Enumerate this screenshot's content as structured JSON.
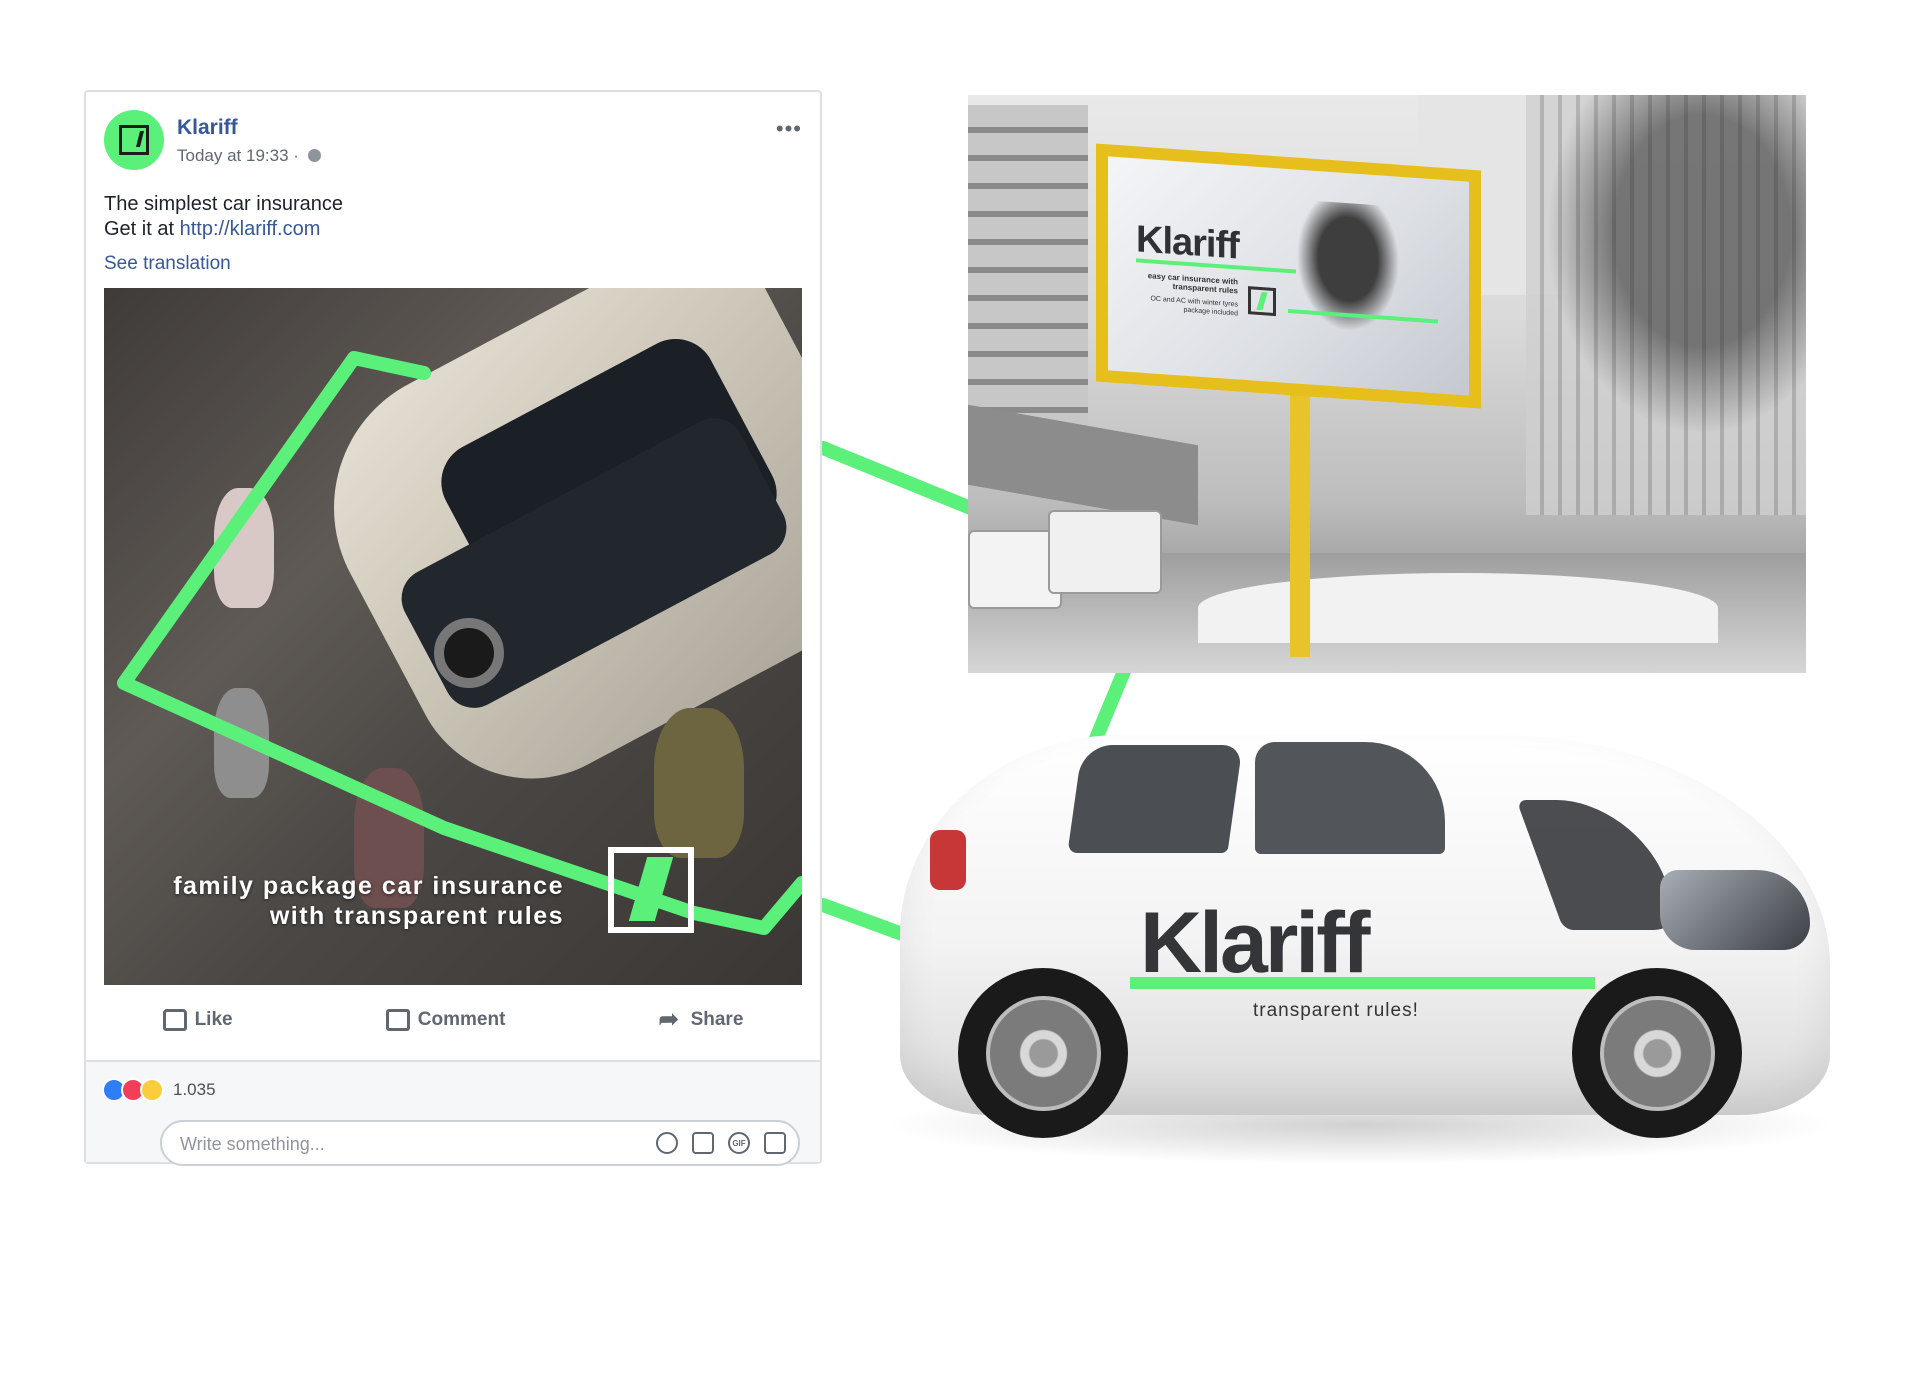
{
  "post": {
    "page_name": "Klariff",
    "timestamp": "Today at 19:33 ·",
    "text_line1": "The simplest car insurance",
    "text_line2_prefix": "Get it at ",
    "text_link": "http://klariff.com",
    "see_translation": "See translation",
    "image_caption_line1": "family package car insurance",
    "image_caption_line2": "with transparent rules",
    "actions": {
      "like": "Like",
      "comment": "Comment",
      "share": "Share"
    },
    "reaction_count": "1.035",
    "comment_placeholder": "Write something...",
    "input_icons": [
      "emoji-icon",
      "camera-icon",
      "gif-icon",
      "sticker-icon"
    ]
  },
  "billboard": {
    "logo": "Klariff",
    "tagline": "easy car insurance with transparent rules",
    "detail": "OC and AC with winter tyres package included"
  },
  "car": {
    "logo": "Klariff",
    "tagline": "transparent rules!"
  },
  "colors": {
    "brand_green": "#5af07a",
    "facebook_blue": "#365899",
    "billboard_frame": "#e6bf1c"
  }
}
